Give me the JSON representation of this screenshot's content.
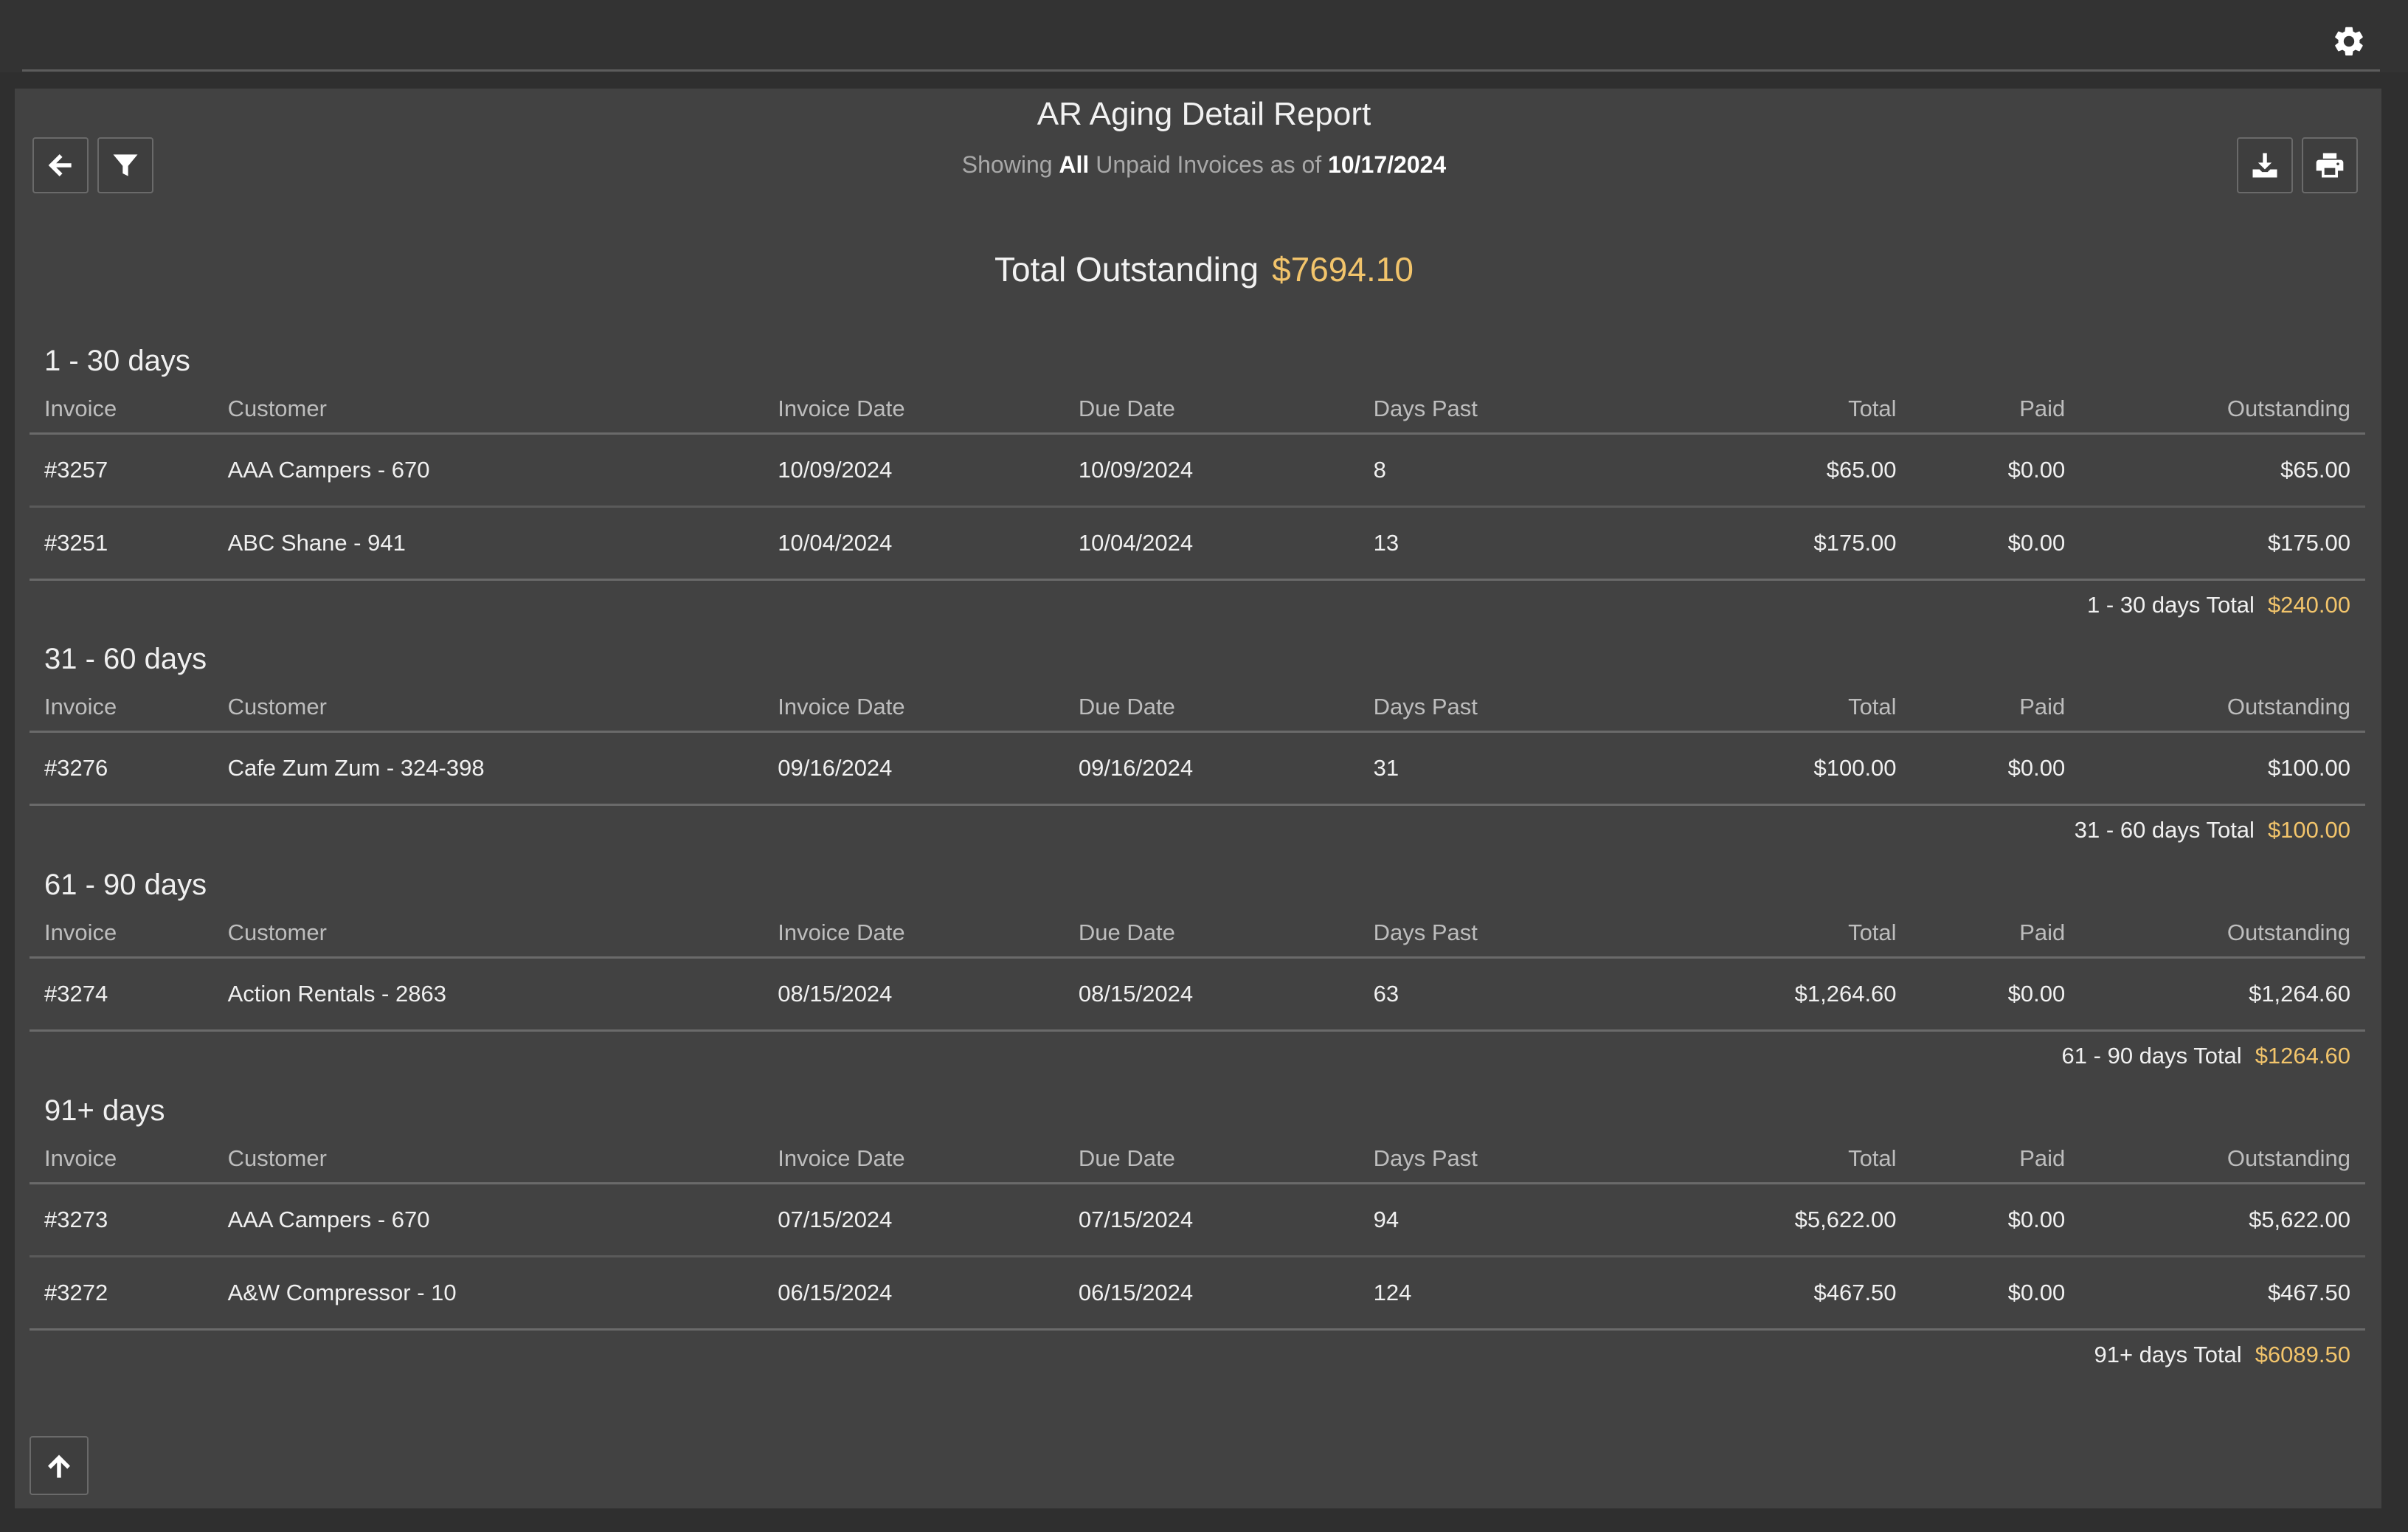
{
  "header": {
    "settings_icon": "gear-icon"
  },
  "toolbar": {
    "back_icon": "arrow-left-icon",
    "filter_icon": "filter-icon",
    "download_icon": "download-icon",
    "print_icon": "print-icon"
  },
  "report": {
    "title": "AR Aging Detail Report",
    "subtitle_prefix": "Showing",
    "subtitle_scope": "All",
    "subtitle_middle": "Unpaid Invoices as of",
    "subtitle_date": "10/17/2024",
    "total_label": "Total Outstanding",
    "total_value": "$7694.10"
  },
  "columns": [
    "Invoice",
    "Customer",
    "Invoice Date",
    "Due Date",
    "Days Past",
    "Total",
    "Paid",
    "Outstanding"
  ],
  "sections": [
    {
      "title": "1 - 30 days",
      "rows": [
        [
          "#3257",
          "AAA Campers - 670",
          "10/09/2024",
          "10/09/2024",
          "8",
          "$65.00",
          "$0.00",
          "$65.00"
        ],
        [
          "#3251",
          "ABC Shane - 941",
          "10/04/2024",
          "10/04/2024",
          "13",
          "$175.00",
          "$0.00",
          "$175.00"
        ]
      ],
      "total_label": "1 - 30 days Total",
      "total_value": "$240.00"
    },
    {
      "title": "31 - 60 days",
      "rows": [
        [
          "#3276",
          "Cafe Zum Zum - 324-398",
          "09/16/2024",
          "09/16/2024",
          "31",
          "$100.00",
          "$0.00",
          "$100.00"
        ]
      ],
      "total_label": "31 - 60 days Total",
      "total_value": "$100.00"
    },
    {
      "title": "61 - 90 days",
      "rows": [
        [
          "#3274",
          "Action Rentals - 2863",
          "08/15/2024",
          "08/15/2024",
          "63",
          "$1,264.60",
          "$0.00",
          "$1,264.60"
        ]
      ],
      "total_label": "61 - 90 days Total",
      "total_value": "$1264.60"
    },
    {
      "title": "91+ days",
      "rows": [
        [
          "#3273",
          "AAA Campers - 670",
          "07/15/2024",
          "07/15/2024",
          "94",
          "$5,622.00",
          "$0.00",
          "$5,622.00"
        ],
        [
          "#3272",
          "A&W Compressor - 10",
          "06/15/2024",
          "06/15/2024",
          "124",
          "$467.50",
          "$0.00",
          "$467.50"
        ]
      ],
      "total_label": "91+ days Total",
      "total_value": "$6089.50"
    }
  ],
  "footer": {
    "scroll_top_icon": "arrow-up-icon"
  },
  "colors": {
    "accent": "#f2c46b",
    "background": "#424242",
    "topbar": "#333333"
  }
}
